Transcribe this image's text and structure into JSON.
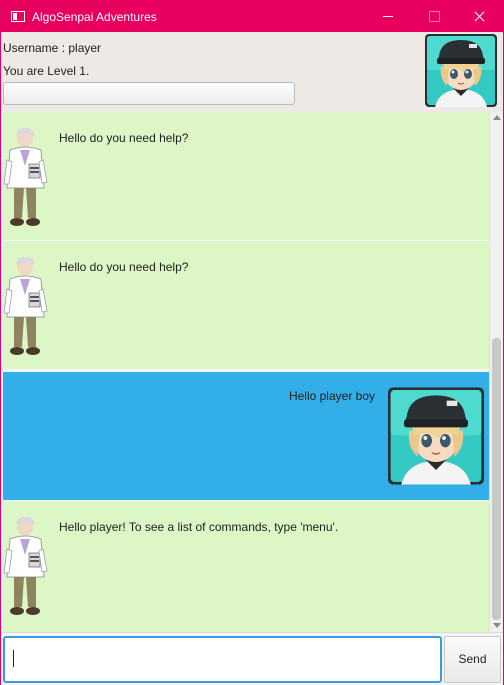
{
  "window": {
    "title": "AlgoSenpai Adventures",
    "accent_color": "#e8005f"
  },
  "header": {
    "username_text": "Username : player",
    "level_text": "You are Level 1.",
    "progress_fraction": 0,
    "avatar_icon": "trainer-avatar-icon"
  },
  "chat": {
    "colors": {
      "bot_bg": "#dcf7c5",
      "user_bg": "#32aee9"
    },
    "messages": [
      {
        "sender": "bot",
        "text": "Hello do you need help?",
        "icon": "professor-sprite-icon"
      },
      {
        "sender": "bot",
        "text": "Hello do you need help?",
        "icon": "professor-sprite-icon"
      },
      {
        "sender": "user",
        "text": "Hello player boy",
        "icon": "trainer-avatar-icon"
      },
      {
        "sender": "bot",
        "text": "Hello player! To see a list of commands, type 'menu'.",
        "icon": "professor-sprite-icon"
      }
    ]
  },
  "input": {
    "value": "",
    "placeholder": "",
    "send_label": "Send"
  }
}
